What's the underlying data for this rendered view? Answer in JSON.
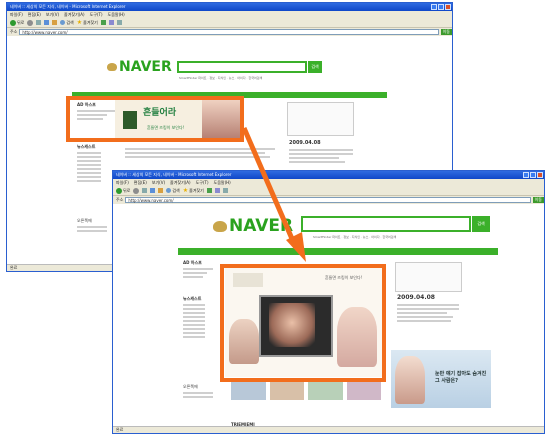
{
  "windows": {
    "back": {
      "title": "네이버 :: 세상의 모든 지식, 네이버 - Microsoft Internet Explorer",
      "address": "http://www.naver.com/",
      "ad_label": "AD 하스프",
      "banner_text": "흔들어라",
      "banner_sub": "흔들면 즈킹이 보인다!",
      "date": "2009.04.08",
      "news_label": "뉴스캐스트",
      "related_label": "오른쪽에"
    },
    "front": {
      "title": "네이버 :: 세상의 모든 지식, 네이버 - Microsoft Internet Explorer",
      "address": "http://www.naver.com/",
      "ad_label": "AD 하스프",
      "banner_text": "흔들면 즈킹이 보인다!",
      "date": "2009.04.08",
      "news_label": "뉴스캐스트",
      "ad_side_text": "눈만 얘기 잡아도 숨겨진 그 사람은?",
      "related_label": "오른쪽에",
      "movie_caption": "TRIEMIEMI",
      "status": "완료"
    }
  },
  "menus": [
    "파일(F)",
    "편집(E)",
    "보기(V)",
    "즐겨찾기(A)",
    "도구(T)",
    "도움말(H)"
  ],
  "toolbar": {
    "back": "뒤로",
    "search": "검색",
    "favorites": "즐겨찾기"
  },
  "naver": {
    "logo": "NAVER",
    "search_button": "검색",
    "links": "SmartFinder 파이트 · 정보 · 지식인 · 뉴스 · 아이다 · 한국어검색"
  },
  "back_status": "완료",
  "colors": {
    "naver_green": "#3bb02a",
    "highlight_orange": "#f26d1c",
    "titlebar_blue": "#0f47c8"
  }
}
